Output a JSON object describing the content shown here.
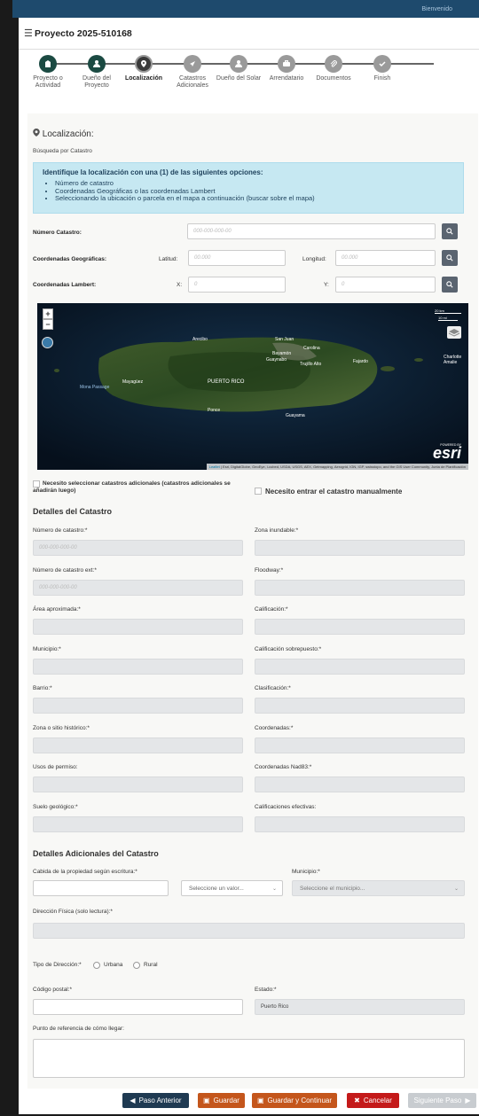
{
  "topbar": {
    "text": "Bienvenido"
  },
  "header": {
    "title": "Proyecto 2025-510168"
  },
  "stepper": {
    "steps": [
      {
        "label": "Proyecto o Actividad",
        "state": "done",
        "icon": "building-icon"
      },
      {
        "label": "Dueño del Proyecto",
        "state": "done",
        "icon": "user-icon"
      },
      {
        "label": "Localización",
        "state": "active",
        "icon": "location-pin-icon"
      },
      {
        "label": "Catastros Adicionales",
        "state": "todo",
        "icon": "compass-icon"
      },
      {
        "label": "Dueño del Solar",
        "state": "todo",
        "icon": "user-icon"
      },
      {
        "label": "Arrendatario",
        "state": "todo",
        "icon": "briefcase-icon"
      },
      {
        "label": "Documentos",
        "state": "todo",
        "icon": "paperclip-icon"
      },
      {
        "label": "Finish",
        "state": "todo",
        "icon": "check-icon"
      }
    ]
  },
  "location": {
    "title": "Localización:",
    "subtitle": "Búsqueda por Catastro",
    "info_title": "Identifique la localización con una (1) de las siguientes opciones:",
    "info_items": [
      "Número de catastro",
      "Coordenadas Geográficas o las coordenadas Lambert",
      "Seleccionando la ubicación o parcela en el mapa a continuación (buscar sobre el mapa)"
    ],
    "catastro_label": "Número Catastro:",
    "catastro_placeholder": "000-000-000-00",
    "geo_label": "Coordenadas Geográficas:",
    "lat_label": "Latitud:",
    "lat_placeholder": "00.000",
    "lon_label": "Longitud:",
    "lon_placeholder": "00.000",
    "lambert_label": "Coordenadas Lambert:",
    "x_label": "X:",
    "x_placeholder": "0",
    "y_label": "Y:",
    "y_placeholder": "0"
  },
  "map": {
    "scale_km": "20 km",
    "scale_mi": "10 mi",
    "places": [
      "Arecibo",
      "San Juan",
      "Carolina",
      "Bayamón",
      "Guaynabo",
      "Trujillo Alto",
      "Fajardo",
      "Mayagüez",
      "PUERTO RICO",
      "Mona Passage",
      "Ponce",
      "Guayama",
      "Charlotte Amalie"
    ],
    "attribution_link": "Leaflet",
    "attribution": "| Esri, DigitalGlobe, GeoEye, i-cubed, USDA, USGS, AEX, Getmapping, Aerogrid, IGN, IGP, swisstopo, and the GIS User Community, Junta de Planificación",
    "powered": "POWERED BY",
    "brand": "esri"
  },
  "checks": {
    "additional": "Necesito seleccionar catastros adicionales (catastros adicionales se añadirán luego)",
    "manual": "Necesito entrar el catastro manualmente"
  },
  "details": {
    "title": "Detalles del Catastro",
    "placeholder": "000-000-000-00",
    "fields_left": [
      "Número de catastro:*",
      "Número de catastro ext:*",
      "Área aproximada:*",
      "Municipio:*",
      "Barrio:*",
      "Zona o sitio histórico:*",
      "Usos de permiso:",
      "Suelo geológico:*"
    ],
    "fields_right": [
      "Zona inundable:*",
      "Floodway:*",
      "Calificación:*",
      "Calificación sobrepuesto:*",
      "Clasificación:*",
      "Coordenadas:*",
      "Coordenadas Nad83:*",
      "Calificaciones efectivas:"
    ]
  },
  "additional": {
    "title": "Detalles Adicionales del Catastro",
    "cabida_label": "Cabida de la propiedad según escritura:*",
    "unit_select": "Seleccione un valor...",
    "municipio_label": "Municipio:*",
    "municipio_select": "Seleccione el municipio...",
    "direccion_label": "Dirección Física (solo lectura):*",
    "tipo_label": "Tipo de Dirección:*",
    "urbana": "Urbana",
    "rural": "Rural",
    "postal_label": "Código postal:*",
    "estado_label": "Estado:*",
    "estado_value": "Puerto Rico",
    "referencia_label": "Punto de referencia de cómo llegar:"
  },
  "footer": {
    "prev": "Paso Anterior",
    "save": "Guardar",
    "save_continue": "Guardar y Continuar",
    "cancel": "Cancelar",
    "next": "Siguiente Paso",
    "colors": {
      "prev": "#1f3a52",
      "save": "#c4561c",
      "cancel": "#c41a1a",
      "next": "#c8ccd0"
    }
  }
}
